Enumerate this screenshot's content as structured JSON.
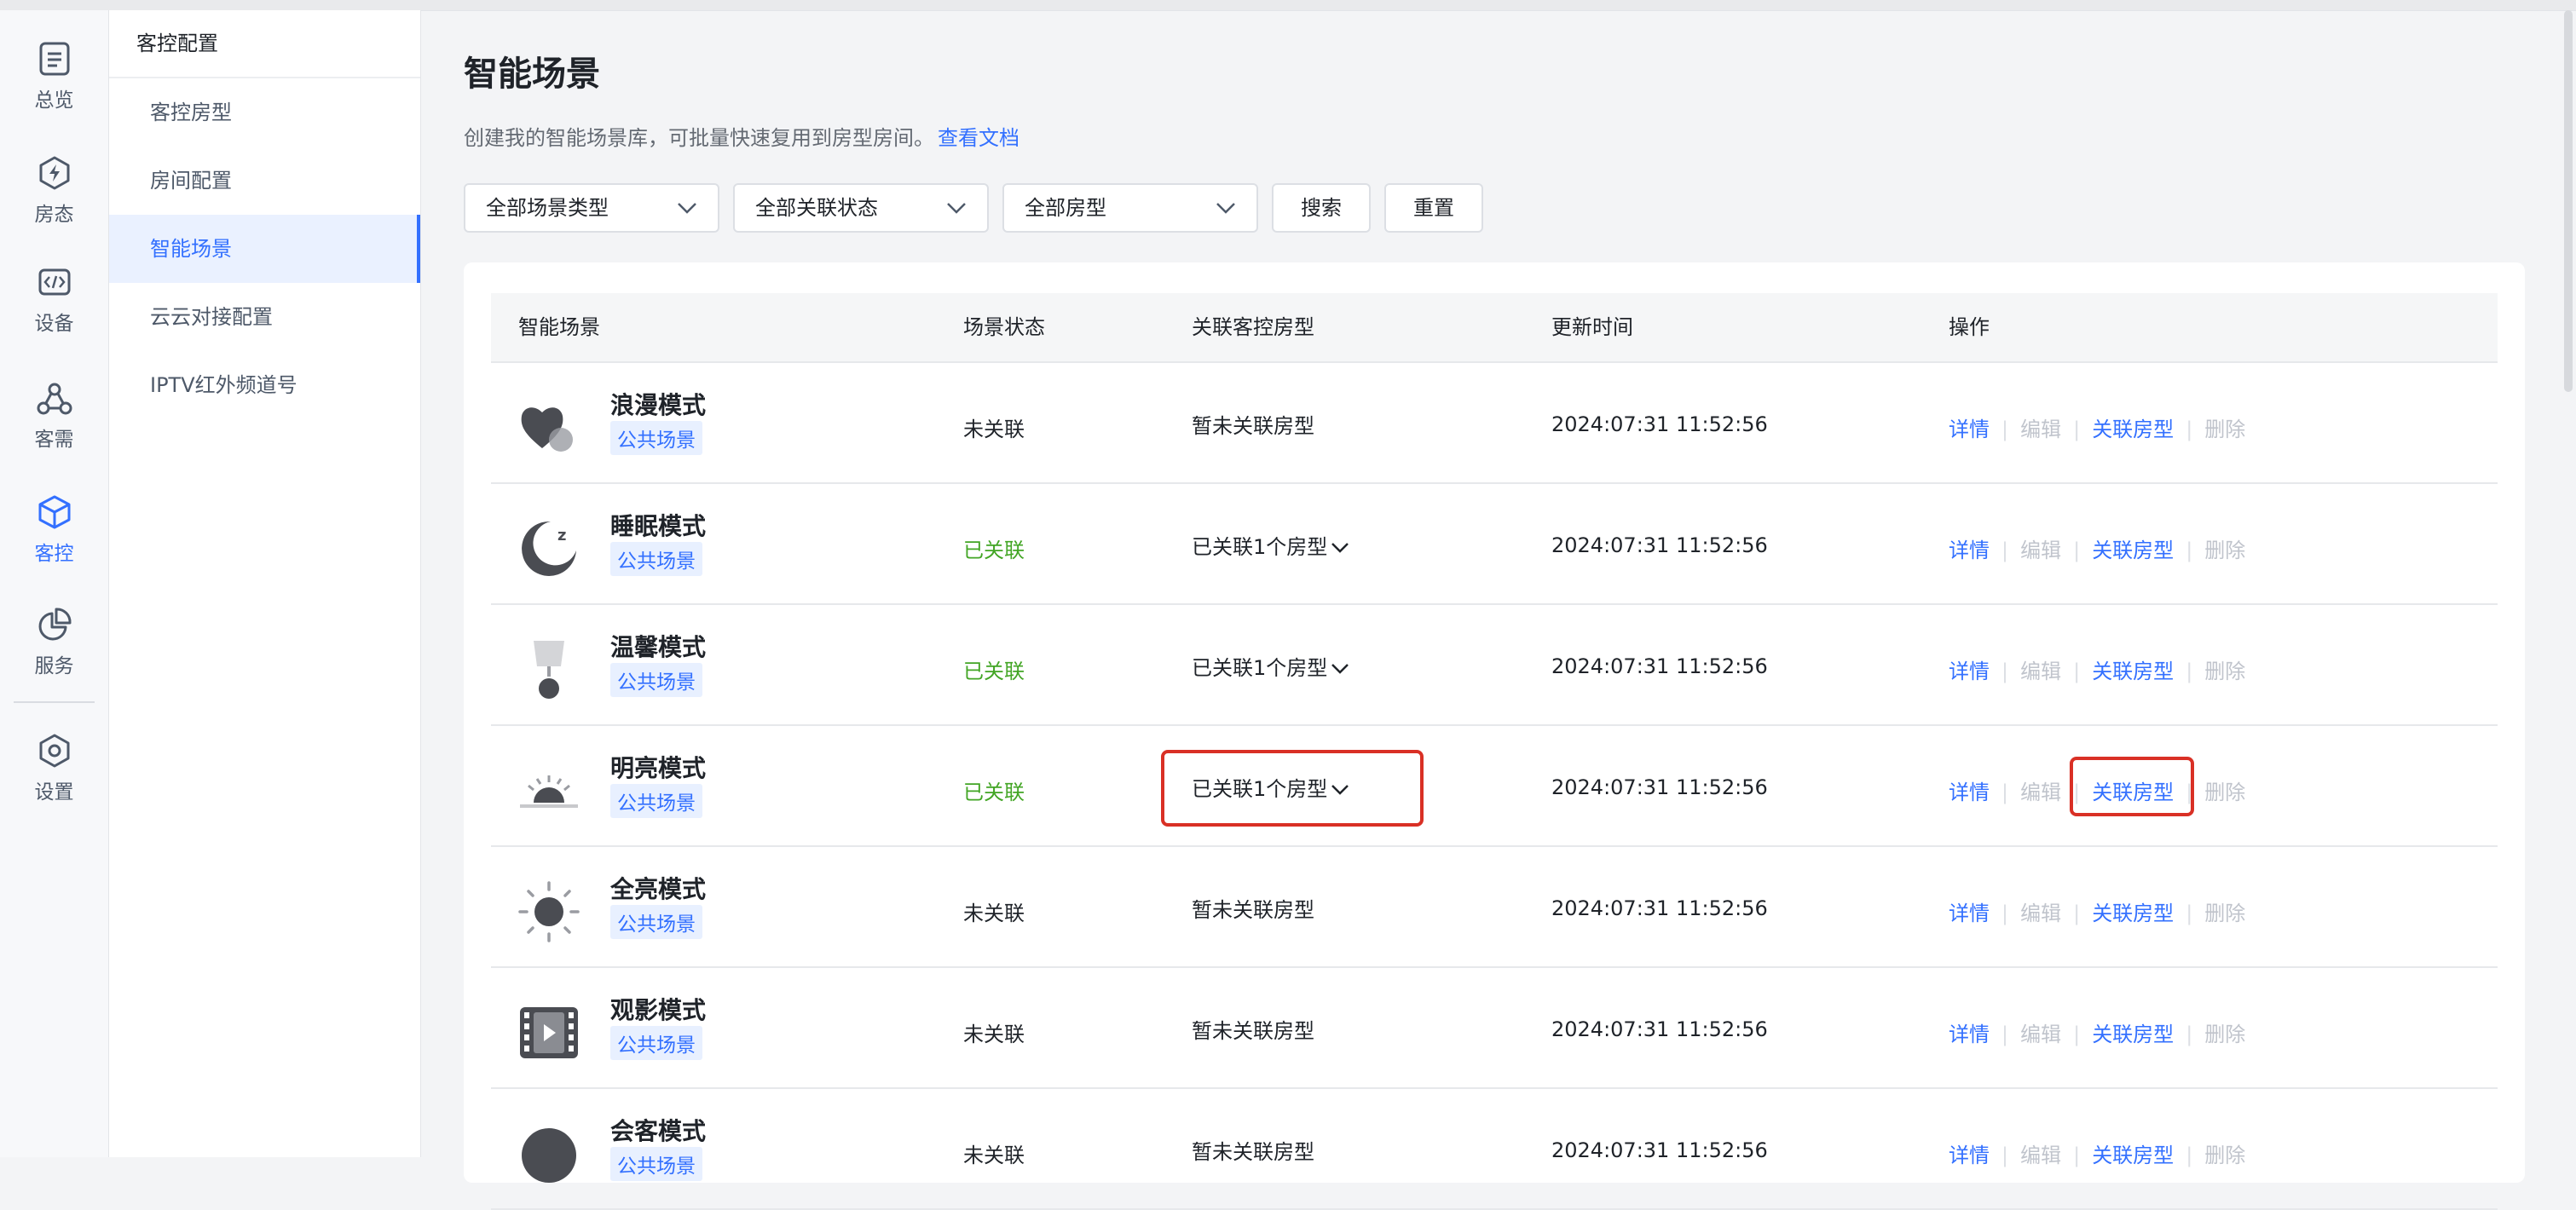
{
  "rail": {
    "items": [
      {
        "label": "总览",
        "icon": "list-doc-icon"
      },
      {
        "label": "房态",
        "icon": "bolt-hexagon-icon"
      },
      {
        "label": "设备",
        "icon": "code-icon"
      },
      {
        "label": "客需",
        "icon": "network-icon"
      },
      {
        "label": "客控",
        "icon": "cube-icon"
      },
      {
        "label": "服务",
        "icon": "pie-chart-icon"
      },
      {
        "label": "设置",
        "icon": "gear-icon"
      }
    ],
    "active": "客控"
  },
  "subnav": {
    "title": "客控配置",
    "items": [
      {
        "label": "客控房型"
      },
      {
        "label": "房间配置"
      },
      {
        "label": "智能场景"
      },
      {
        "label": "云云对接配置"
      },
      {
        "label": "IPTV红外频道号"
      }
    ],
    "active": "智能场景"
  },
  "page": {
    "title": "智能场景",
    "description": "创建我的智能场景库，可批量快速复用到房型房间。",
    "doc_link": "查看文档"
  },
  "filters": {
    "scene_type": "全部场景类型",
    "link_status": "全部关联状态",
    "room_type": "全部房型",
    "search_label": "搜索",
    "reset_label": "重置"
  },
  "table": {
    "headers": [
      "智能场景",
      "场景状态",
      "关联客控房型",
      "更新时间",
      "操作"
    ],
    "actions": {
      "detail": "详情",
      "edit": "编辑",
      "link": "关联房型",
      "delete": "删除"
    },
    "rows": [
      {
        "name": "浪漫模式",
        "tag": "公共场景",
        "status": "未关联",
        "linked": false,
        "assoc": "暂未关联房型",
        "time": "2024:07:31 11:52:56",
        "icon": "heart-icon"
      },
      {
        "name": "睡眠模式",
        "tag": "公共场景",
        "status": "已关联",
        "linked": true,
        "assoc": "已关联1个房型",
        "time": "2024:07:31 11:52:56",
        "icon": "moon-icon"
      },
      {
        "name": "温馨模式",
        "tag": "公共场景",
        "status": "已关联",
        "linked": true,
        "assoc": "已关联1个房型",
        "time": "2024:07:31 11:52:56",
        "icon": "lamp-icon"
      },
      {
        "name": "明亮模式",
        "tag": "公共场景",
        "status": "已关联",
        "linked": true,
        "assoc": "已关联1个房型",
        "time": "2024:07:31 11:52:56",
        "icon": "sunrise-icon"
      },
      {
        "name": "全亮模式",
        "tag": "公共场景",
        "status": "未关联",
        "linked": false,
        "assoc": "暂未关联房型",
        "time": "2024:07:31 11:52:56",
        "icon": "sun-icon"
      },
      {
        "name": "观影模式",
        "tag": "公共场景",
        "status": "未关联",
        "linked": false,
        "assoc": "暂未关联房型",
        "time": "2024:07:31 11:52:56",
        "icon": "film-icon"
      },
      {
        "name": "会客模式",
        "tag": "公共场景",
        "status": "未关联",
        "linked": false,
        "assoc": "暂未关联房型",
        "time": "2024:07:31 11:52:56",
        "icon": "guest-icon"
      }
    ]
  },
  "colors": {
    "accent": "#3370ff",
    "linked": "#42a524",
    "highlight": "#d93025",
    "disabled": "#c0c4cc"
  }
}
